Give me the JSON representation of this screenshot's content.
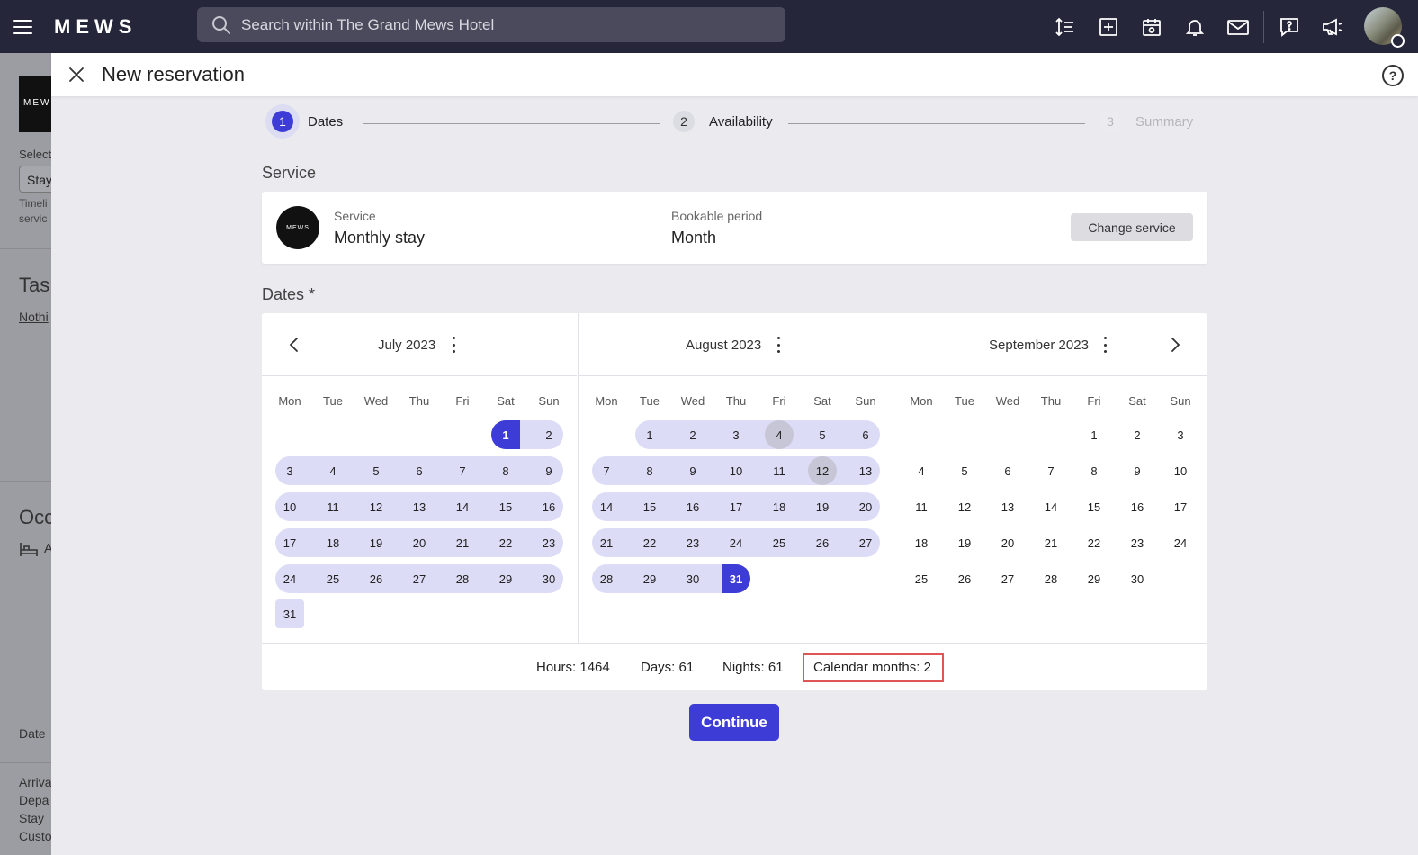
{
  "topbar": {
    "logo": "MEWS",
    "search_placeholder": "Search within The Grand Mews Hotel",
    "icons": [
      "sort-icon",
      "add-icon",
      "calendar-icon",
      "bell-icon",
      "mail-icon",
      "help-chat-icon",
      "announcement-icon"
    ]
  },
  "background": {
    "logo": "MEWS",
    "select_label": "Select",
    "select_value": "Stay",
    "hint_line1": "Timeli",
    "hint_line2": "servic",
    "tasks_title": "Tas",
    "tasks_link": "Nothi",
    "occupancy_title": "Occ",
    "occupancy_item": "A",
    "date_label": "Date",
    "rows": [
      "Arriva",
      "Depa",
      "Stay",
      "Custo"
    ]
  },
  "modal": {
    "title": "New reservation",
    "steps": [
      {
        "num": "1",
        "label": "Dates"
      },
      {
        "num": "2",
        "label": "Availability"
      },
      {
        "num": "3",
        "label": "Summary"
      }
    ],
    "service_section": "Service",
    "service": {
      "logo_text": "MEWS",
      "service_label": "Service",
      "service_value": "Monthly stay",
      "period_label": "Bookable period",
      "period_value": "Month",
      "change_button": "Change service"
    },
    "dates_section": "Dates *",
    "weekdays": [
      "Mon",
      "Tue",
      "Wed",
      "Thu",
      "Fri",
      "Sat",
      "Sun"
    ],
    "months": [
      {
        "title": "July 2023",
        "offset": 5,
        "days": 31
      },
      {
        "title": "August 2023",
        "offset": 1,
        "days": 31
      },
      {
        "title": "September 2023",
        "offset": 4,
        "days": 30
      }
    ],
    "selection": {
      "start": "July 1, 2023",
      "end": "August 31, 2023",
      "hover_days": [
        "August 4, 2023",
        "August 12, 2023"
      ]
    },
    "footer": {
      "hours": "Hours: 1464",
      "days": "Days: 61",
      "nights": "Nights: 61",
      "calendar_months": "Calendar months: 2"
    },
    "continue_button": "Continue"
  },
  "colors": {
    "accent": "#3e3cd6",
    "range": "#dcdcf6",
    "topbar": "#26263a",
    "highlight": "#e05555"
  }
}
